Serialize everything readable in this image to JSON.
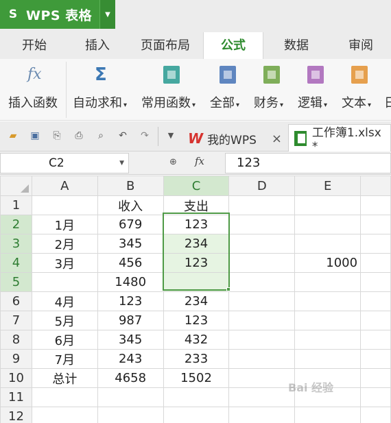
{
  "app": {
    "logo": "S",
    "title": "WPS 表格"
  },
  "menu_tabs": [
    "开始",
    "插入",
    "页面布局",
    "公式",
    "数据",
    "审阅"
  ],
  "ribbon": {
    "insert_function": "插入函数",
    "autosum": "自动求和",
    "common_functions": "常用函数",
    "all": "全部",
    "finance": "财务",
    "logic": "逻辑",
    "text": "文本",
    "date_partial": "日",
    "fx_symbol": "fx",
    "sigma_symbol": "Σ",
    "dropdown_arrow": "▾"
  },
  "doc_tabs": {
    "mywps": "我的WPS",
    "mywps_close": "×",
    "workbook": "工作簿1.xlsx *"
  },
  "formula_bar": {
    "cell_ref": "C2",
    "fx": "fx",
    "value": "123"
  },
  "grid": {
    "columns": [
      "A",
      "B",
      "C",
      "D",
      "E"
    ],
    "rows": [
      {
        "n": "1",
        "a": "",
        "b": "收入",
        "c": "支出",
        "d": "",
        "e": ""
      },
      {
        "n": "2",
        "a": "1月",
        "b": "679",
        "c": "123",
        "d": "",
        "e": ""
      },
      {
        "n": "3",
        "a": "2月",
        "b": "345",
        "c": "234",
        "d": "",
        "e": ""
      },
      {
        "n": "4",
        "a": "3月",
        "b": "456",
        "c": "123",
        "d": "",
        "e": "1000"
      },
      {
        "n": "5",
        "a": "",
        "b": "1480",
        "c": "",
        "d": "",
        "e": ""
      },
      {
        "n": "6",
        "a": "4月",
        "b": "123",
        "c": "234",
        "d": "",
        "e": ""
      },
      {
        "n": "7",
        "a": "5月",
        "b": "987",
        "c": "123",
        "d": "",
        "e": ""
      },
      {
        "n": "8",
        "a": "6月",
        "b": "345",
        "c": "432",
        "d": "",
        "e": ""
      },
      {
        "n": "9",
        "a": "7月",
        "b": "243",
        "c": "233",
        "d": "",
        "e": ""
      },
      {
        "n": "10",
        "a": "总计",
        "b": "4658",
        "c": "1502",
        "d": "",
        "e": ""
      },
      {
        "n": "11",
        "a": "",
        "b": "",
        "c": "",
        "d": "",
        "e": ""
      },
      {
        "n": "12",
        "a": "",
        "b": "",
        "c": "",
        "d": "",
        "e": ""
      }
    ]
  },
  "watermark": "Bai 经验",
  "colors": {
    "accent": "#3f9a3a",
    "selection": "#4e9a46",
    "selection_fill": "#e6f4e2"
  }
}
